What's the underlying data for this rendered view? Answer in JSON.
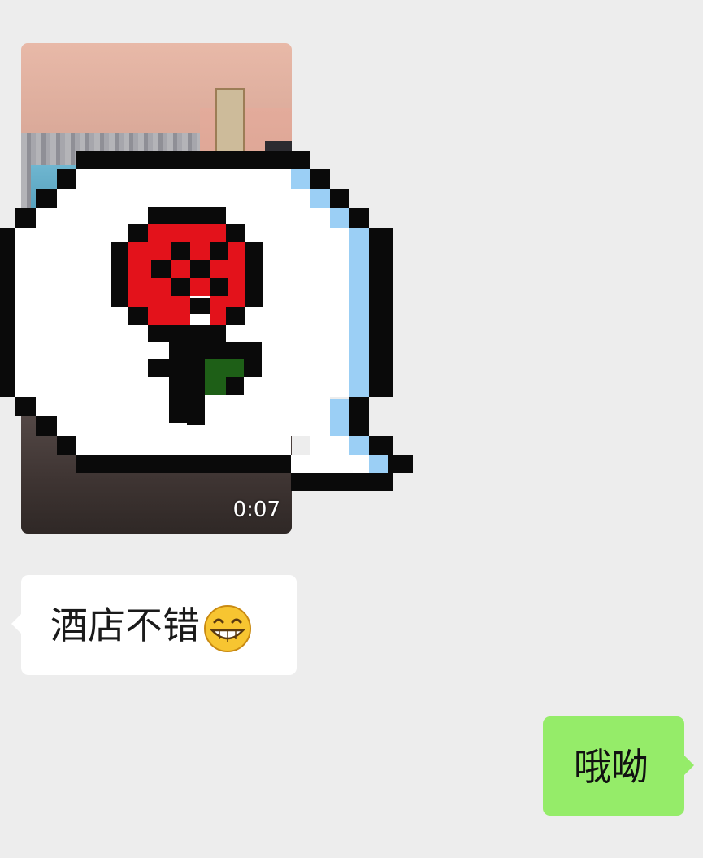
{
  "messages": {
    "video": {
      "duration": "0:07"
    },
    "incoming_text": "酒店不错",
    "incoming_emoji": "grinning-face-emoji",
    "outgoing_text": "哦呦"
  },
  "colors": {
    "background": "#ededed",
    "incoming_bubble": "#ffffff",
    "outgoing_bubble": "#95ec69",
    "rose_red": "#e3121b",
    "leaf_green": "#1e5f17",
    "sticker_shadow": "#9bcff5"
  }
}
